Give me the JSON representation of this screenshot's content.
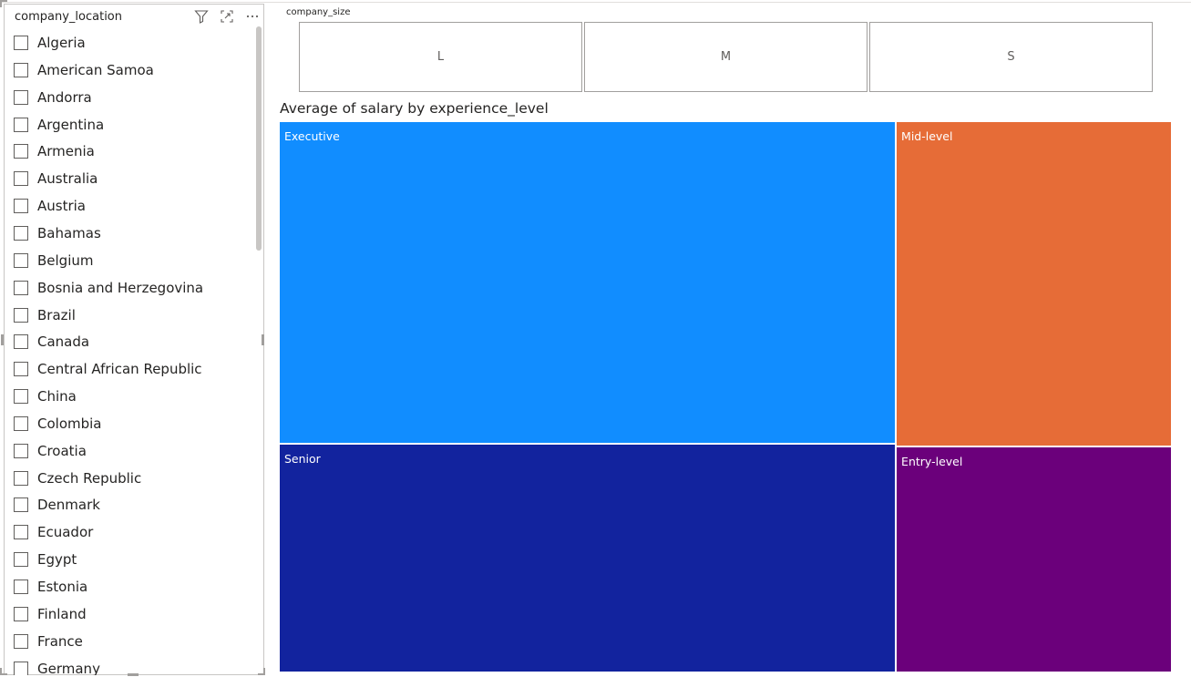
{
  "slicer": {
    "title": "company_location",
    "icons": [
      "filter-icon",
      "focus-mode-icon",
      "more-options-icon"
    ],
    "items": [
      "Algeria",
      "American Samoa",
      "Andorra",
      "Argentina",
      "Armenia",
      "Australia",
      "Austria",
      "Bahamas",
      "Belgium",
      "Bosnia and Herzegovina",
      "Brazil",
      "Canada",
      "Central African Republic",
      "China",
      "Colombia",
      "Croatia",
      "Czech Republic",
      "Denmark",
      "Ecuador",
      "Egypt",
      "Estonia",
      "Finland",
      "France",
      "Germany"
    ]
  },
  "size_slicer": {
    "title": "company_size",
    "options": [
      "L",
      "M",
      "S"
    ]
  },
  "chart": {
    "title": "Average of salary by experience_level"
  },
  "chart_data": {
    "type": "treemap",
    "title": "Average of salary by experience_level",
    "categories": [
      "Executive",
      "Senior",
      "Mid-level",
      "Entry-level"
    ],
    "values": [
      195,
      138,
      88,
      61
    ],
    "colors": [
      "#118dff",
      "#12239e",
      "#e66c37",
      "#6b007b"
    ]
  }
}
